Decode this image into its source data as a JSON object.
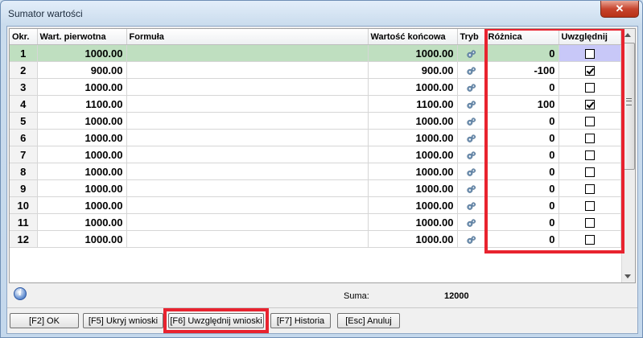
{
  "window": {
    "title": "Sumator wartości",
    "close_glyph": "✕"
  },
  "table": {
    "headers": [
      "Okr.",
      "Wart. pierwotna",
      "Formuła",
      "Wartość końcowa",
      "Tryb",
      "Różnica",
      "Uwzględnij"
    ],
    "rows": [
      {
        "okr": "1",
        "wart": "1000.00",
        "formula": "",
        "koncowa": "1000.00",
        "tryb_icon": "gear-icon",
        "roznica": "0",
        "uwzglednij": false
      },
      {
        "okr": "2",
        "wart": "900.00",
        "formula": "",
        "koncowa": "900.00",
        "tryb_icon": "gear-icon",
        "roznica": "-100",
        "uwzglednij": true
      },
      {
        "okr": "3",
        "wart": "1000.00",
        "formula": "",
        "koncowa": "1000.00",
        "tryb_icon": "gear-icon",
        "roznica": "0",
        "uwzglednij": false
      },
      {
        "okr": "4",
        "wart": "1100.00",
        "formula": "",
        "koncowa": "1100.00",
        "tryb_icon": "gear-icon",
        "roznica": "100",
        "uwzglednij": true
      },
      {
        "okr": "5",
        "wart": "1000.00",
        "formula": "",
        "koncowa": "1000.00",
        "tryb_icon": "gear-icon",
        "roznica": "0",
        "uwzglednij": false
      },
      {
        "okr": "6",
        "wart": "1000.00",
        "formula": "",
        "koncowa": "1000.00",
        "tryb_icon": "gear-icon",
        "roznica": "0",
        "uwzglednij": false
      },
      {
        "okr": "7",
        "wart": "1000.00",
        "formula": "",
        "koncowa": "1000.00",
        "tryb_icon": "gear-icon",
        "roznica": "0",
        "uwzglednij": false
      },
      {
        "okr": "8",
        "wart": "1000.00",
        "formula": "",
        "koncowa": "1000.00",
        "tryb_icon": "gear-icon",
        "roznica": "0",
        "uwzglednij": false
      },
      {
        "okr": "9",
        "wart": "1000.00",
        "formula": "",
        "koncowa": "1000.00",
        "tryb_icon": "gear-icon",
        "roznica": "0",
        "uwzglednij": false
      },
      {
        "okr": "10",
        "wart": "1000.00",
        "formula": "",
        "koncowa": "1000.00",
        "tryb_icon": "gear-icon",
        "roznica": "0",
        "uwzglednij": false
      },
      {
        "okr": "11",
        "wart": "1000.00",
        "formula": "",
        "koncowa": "1000.00",
        "tryb_icon": "gear-icon",
        "roznica": "0",
        "uwzglednij": false
      },
      {
        "okr": "12",
        "wart": "1000.00",
        "formula": "",
        "koncowa": "1000.00",
        "tryb_icon": "gear-icon",
        "roznica": "0",
        "uwzglednij": false
      }
    ],
    "selected_row": 0
  },
  "footer": {
    "info_icon": "info-icon",
    "info_glyph": "i",
    "suma_label": "Suma:",
    "suma_value": "12000"
  },
  "buttons": {
    "ok": "[F2] OK",
    "hide": "[F5] Ukryj wnioski",
    "include": "[F6] Uwzględnij wnioski",
    "history": "[F7] Historia",
    "cancel": "[Esc] Anuluj"
  },
  "colors": {
    "highlight": "#e8232f",
    "selected_row": "#bfdfc0",
    "selected_check_cell": "#c8c8f8"
  }
}
